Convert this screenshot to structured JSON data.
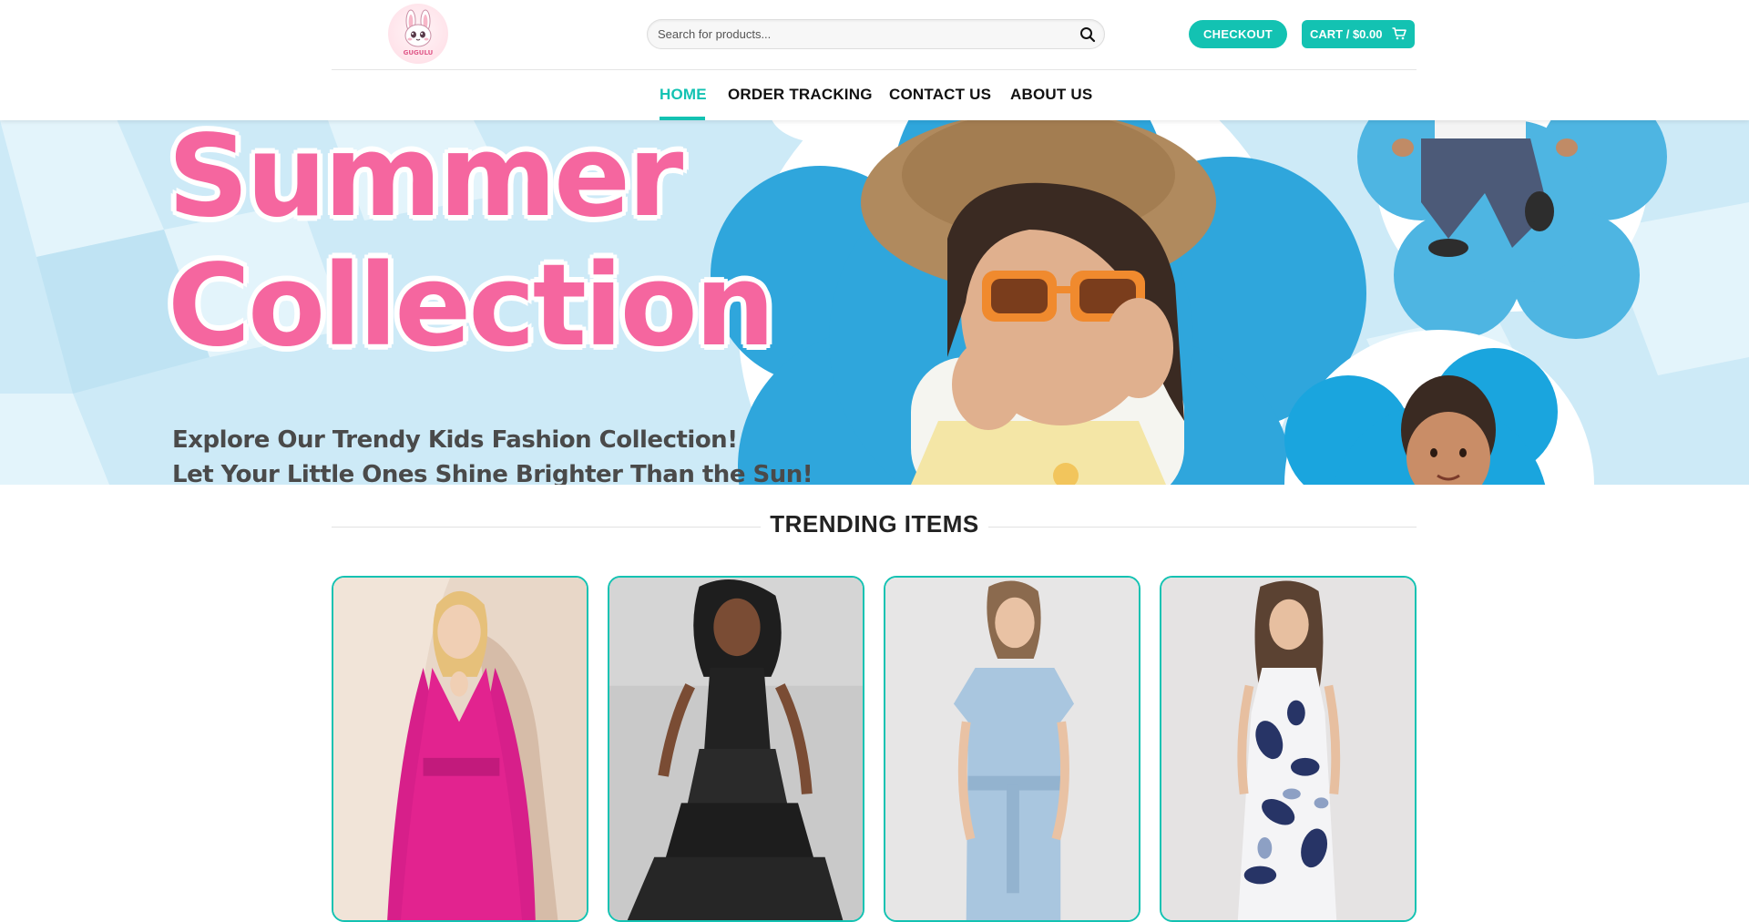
{
  "header": {
    "logo_name": "bunny-logo",
    "logo_text": "GUGULU",
    "search": {
      "placeholder": "Search for products...",
      "value": ""
    },
    "checkout_label": "CHECKOUT",
    "cart_label": "CART / $0.00"
  },
  "nav": {
    "items": [
      {
        "label": "HOME",
        "active": true
      },
      {
        "label": "ORDER TRACKING",
        "active": false
      },
      {
        "label": "CONTACT US",
        "active": false
      },
      {
        "label": "ABOUT US",
        "active": false
      }
    ]
  },
  "hero": {
    "title_line1": "Summer",
    "title_line2": "Collection",
    "subtitle_line1": "Explore Our Trendy Kids Fashion Collection!",
    "subtitle_line2": "Let Your Little Ones Shine Brighter Than the Sun!"
  },
  "trending": {
    "title": "TRENDING ITEMS",
    "products": [
      {
        "image": "pink-dress-photo"
      },
      {
        "image": "black-tiered-dress-photo"
      },
      {
        "image": "light-blue-dress-photo"
      },
      {
        "image": "floral-print-dress-photo"
      }
    ]
  },
  "colors": {
    "accent": "#13c2b2",
    "hero_title": "#f5669f",
    "hero_bg": "#cbe9f6",
    "flower_blue": "#2fa6dc"
  }
}
